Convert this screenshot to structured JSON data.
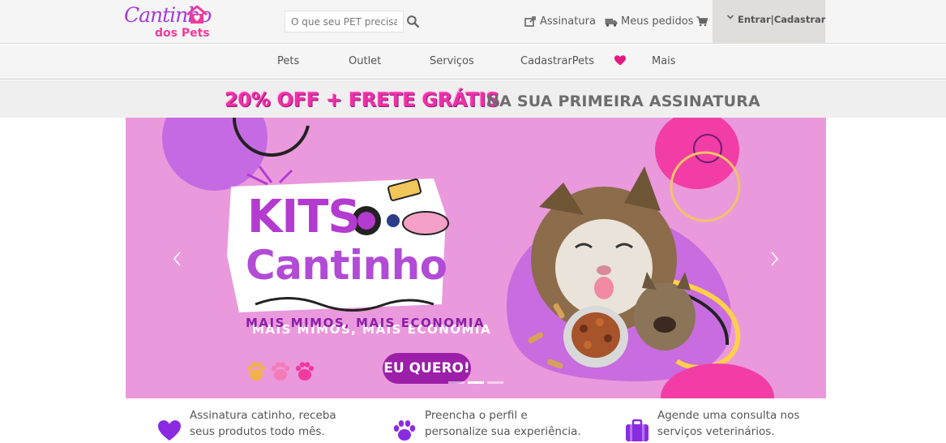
{
  "header": {
    "logo": {
      "script": "Cantinho",
      "sub": "dos Pets"
    },
    "search": {
      "placeholder": "O que seu PET precisa?"
    },
    "links": {
      "subscription": "Assinatura",
      "orders": "Meus pedidos"
    },
    "login": "Entrar|Cadastrar"
  },
  "nav": {
    "items": [
      "Pets",
      "Outlet",
      "Serviços",
      "CadastrarPets",
      "Mais"
    ]
  },
  "promo": {
    "highlight": "20% OFF + FRETE GRÁTIS",
    "rest": "NA SUA PRIMEIRA ASSINATURA"
  },
  "hero": {
    "title1": "KITS",
    "title2": "Cantinho",
    "tagline": "MAIS MIMOS, MAIS ECONOMIA",
    "cta": "EU QUERO!",
    "slides_count": 3,
    "active_slide": 2
  },
  "features": [
    {
      "icon": "heart-icon",
      "text": "Assinatura catinho, receba seus produtos todo mês."
    },
    {
      "icon": "paw-icon",
      "text": "Preencha o perfil e personalize sua experiência."
    },
    {
      "icon": "briefcase-icon",
      "text": "Agende uma consulta nos serviços veterinários."
    }
  ],
  "colors": {
    "brand_purple": "#a43be0",
    "brand_pink": "#ee3c9b",
    "hero_bg": "#ea99dc",
    "promo_pink": "#ef2fa8",
    "feature_icon": "#8a2be2"
  }
}
